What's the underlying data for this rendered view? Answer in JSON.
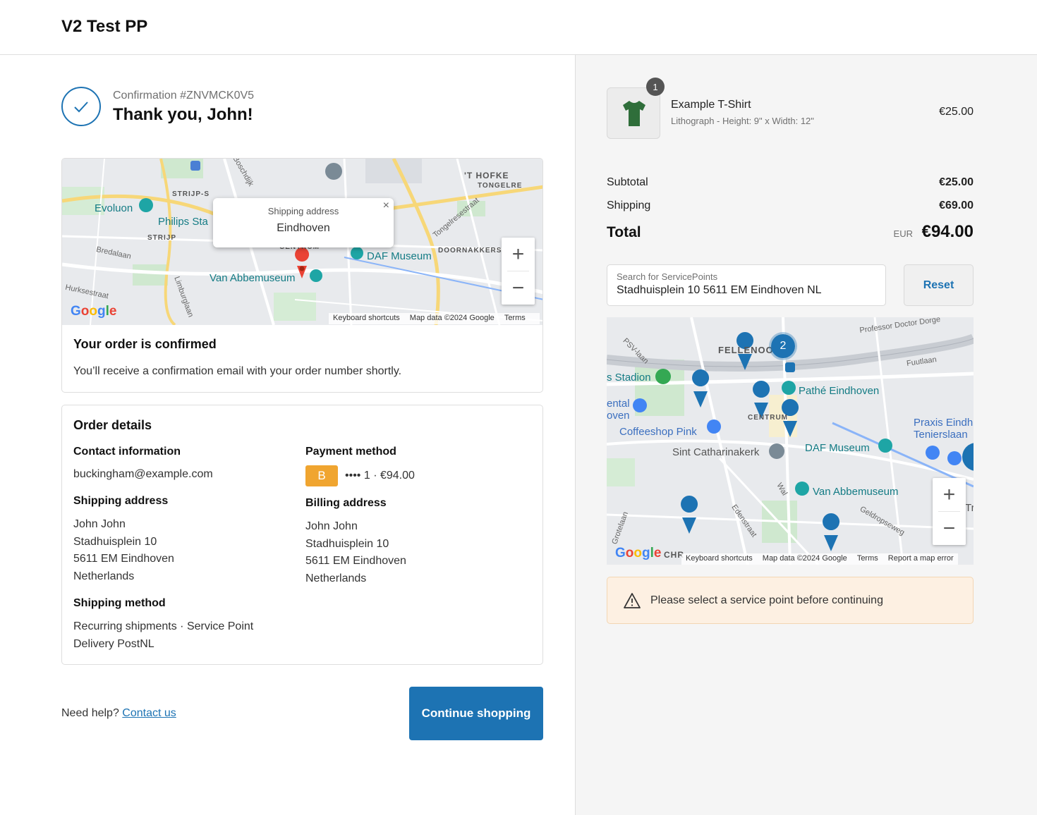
{
  "header": {
    "store_name": "V2 Test PP"
  },
  "confirmation": {
    "number_label": "Confirmation #ZNVMCK0V5",
    "thank_you": "Thank you, John!"
  },
  "shipping_map": {
    "labels": {
      "evoluon": "Evoluon",
      "philips": "Philips Sta",
      "strijps": "STRIJP-S",
      "strijp": "STRIJP",
      "bredalaan": "Bredalaan",
      "hurksestraat": "Hurksestraat",
      "limburglaan": "Limburglaan",
      "boschdijk": "Boschdijk",
      "hofke": "'T HOFKE",
      "tongelre": "TONGELRE",
      "tongelresestraat": "Tongelresestraat",
      "doornakkers": "DOORNAKKERS",
      "daf": "DAF Museum",
      "centrum": "CENTRUM",
      "vanabbe": "Van Abbemuseum"
    },
    "info_window": {
      "title": "Shipping address",
      "city": "Eindhoven",
      "close": "×"
    },
    "zoom_in": "+",
    "zoom_out": "−",
    "attribution": {
      "shortcuts": "Keyboard shortcuts",
      "data": "Map data ©2024 Google",
      "terms": "Terms"
    }
  },
  "google_logo": [
    "G",
    "o",
    "o",
    "g",
    "l",
    "e"
  ],
  "confirmed": {
    "title": "Your order is confirmed",
    "text": "You’ll receive a confirmation email with your order number shortly."
  },
  "order_details": {
    "title": "Order details",
    "contact_heading": "Contact information",
    "contact_email": "buckingham@example.com",
    "shipping_address_heading": "Shipping address",
    "shipping_address": [
      "John John",
      "Stadhuisplein 10",
      "5611 EM Eindhoven",
      "Netherlands"
    ],
    "shipping_method_heading": "Shipping method",
    "shipping_method": [
      "Recurring shipments · Service Point",
      "Delivery PostNL"
    ],
    "payment_heading": "Payment method",
    "payment_badge": "B",
    "payment_text": "•••• 1 · €94.00",
    "billing_heading": "Billing address",
    "billing_address": [
      "John John",
      "Stadhuisplein 10",
      "5611 EM Eindhoven",
      "Netherlands"
    ]
  },
  "footer": {
    "need_help": "Need help?",
    "contact_link": "Contact us",
    "continue_button": "Continue shopping"
  },
  "cart": {
    "quantity": "1",
    "product_name": "Example T-Shirt",
    "product_variant": "Lithograph - Height: 9\" x Width: 12\"",
    "product_price": "€25.00"
  },
  "summary": {
    "subtotal_label": "Subtotal",
    "subtotal_value": "€25.00",
    "shipping_label": "Shipping",
    "shipping_value": "€69.00",
    "total_label": "Total",
    "total_currency": "EUR",
    "total_value": "€94.00"
  },
  "service_points": {
    "search_label": "Search for ServicePoints",
    "search_value": "Stadhuisplein 10 5611 EM Eindhoven NL",
    "reset_button": "Reset",
    "cluster_count": "2",
    "cluster_partial": "2",
    "map_labels": {
      "felleno": "FELLENOORD",
      "stadion": "s Stadion",
      "pathe": "Pathé Eindhoven",
      "ental": "ental",
      "oven": "oven",
      "coffeeshop": "Coffeeshop Pink",
      "centrum": "CENTRUM",
      "praxis1": "Praxis Eindh",
      "praxis2": "Tenierslaan",
      "catharina": "Sint Catharinakerk",
      "daf": "DAF Museum",
      "vanabbe": "Van Abbemuseum",
      "professor": "Professor Doctor Dorge",
      "fuutlaan": "Fuutlaan",
      "psvlaan": "PSV-laan",
      "wal": "Wal",
      "edenstraat": "Edenstraat",
      "geldropseweg": "Geldropseweg",
      "grotelaan": "Grotelaan",
      "tr": "Tr",
      "chr": "CHR"
    },
    "zoom_in": "+",
    "zoom_out": "−",
    "attribution": {
      "shortcuts": "Keyboard shortcuts",
      "data": "Map data ©2024 Google",
      "terms": "Terms",
      "report": "Report a map error"
    }
  },
  "warning": {
    "text": "Please select a service point before continuing"
  }
}
